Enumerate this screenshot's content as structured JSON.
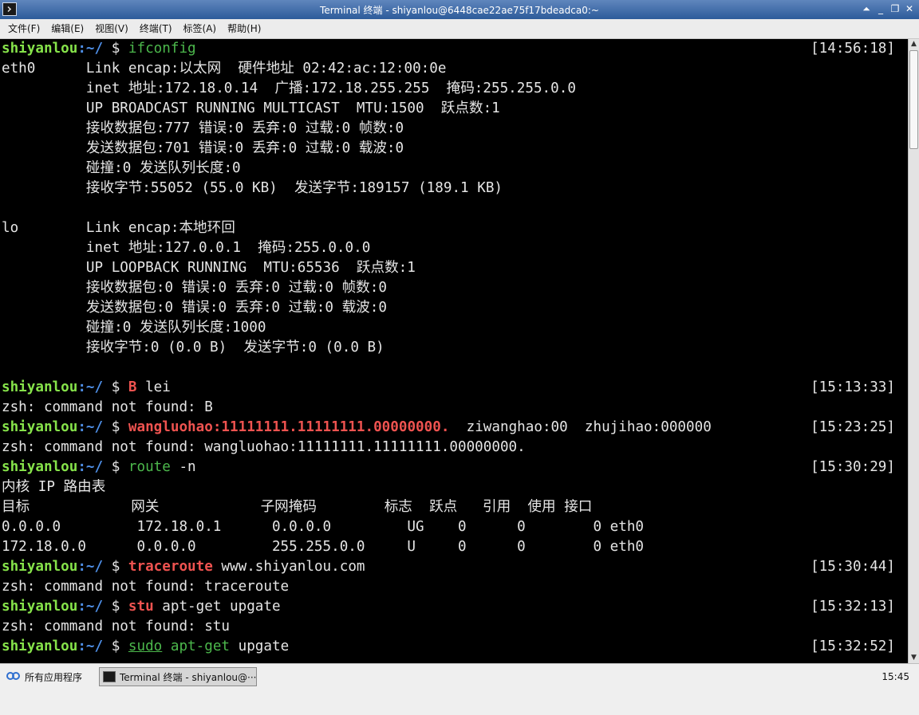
{
  "window": {
    "title": "Terminal 终端 - shiyanlou@6448cae22ae75f17bdeadca0:~",
    "controls": [
      "⏶",
      "_",
      "❐",
      "✕"
    ]
  },
  "menubar": {
    "items": [
      "文件(F)",
      "编辑(E)",
      "视图(V)",
      "终端(T)",
      "标签(A)",
      "帮助(H)"
    ]
  },
  "terminal": {
    "prompt_user": "shiyanlou",
    "prompt_path": ":~/",
    "prompt_symbol": " $ ",
    "lines": [
      {
        "type": "prompt",
        "cmd": "ifconfig",
        "cmd_style": "g",
        "ts": "[14:56:18]"
      },
      {
        "type": "out",
        "text": "eth0      Link encap:以太网  硬件地址 02:42:ac:12:00:0e"
      },
      {
        "type": "out",
        "text": "          inet 地址:172.18.0.14  广播:172.18.255.255  掩码:255.255.0.0"
      },
      {
        "type": "out",
        "text": "          UP BROADCAST RUNNING MULTICAST  MTU:1500  跃点数:1"
      },
      {
        "type": "out",
        "text": "          接收数据包:777 错误:0 丢弃:0 过载:0 帧数:0"
      },
      {
        "type": "out",
        "text": "          发送数据包:701 错误:0 丢弃:0 过载:0 载波:0"
      },
      {
        "type": "out",
        "text": "          碰撞:0 发送队列长度:0"
      },
      {
        "type": "out",
        "text": "          接收字节:55052 (55.0 KB)  发送字节:189157 (189.1 KB)"
      },
      {
        "type": "out",
        "text": ""
      },
      {
        "type": "out",
        "text": "lo        Link encap:本地环回"
      },
      {
        "type": "out",
        "text": "          inet 地址:127.0.0.1  掩码:255.0.0.0"
      },
      {
        "type": "out",
        "text": "          UP LOOPBACK RUNNING  MTU:65536  跃点数:1"
      },
      {
        "type": "out",
        "text": "          接收数据包:0 错误:0 丢弃:0 过载:0 帧数:0"
      },
      {
        "type": "out",
        "text": "          发送数据包:0 错误:0 丢弃:0 过载:0 载波:0"
      },
      {
        "type": "out",
        "text": "          碰撞:0 发送队列长度:1000"
      },
      {
        "type": "out",
        "text": "          接收字节:0 (0.0 B)  发送字节:0 (0.0 B)"
      },
      {
        "type": "out",
        "text": ""
      },
      {
        "type": "prompt",
        "cmd": "B",
        "cmd_style": "r",
        "args": " lei",
        "ts": "[15:13:33]"
      },
      {
        "type": "out",
        "text": "zsh: command not found: B"
      },
      {
        "type": "prompt",
        "cmd": "wangluohao:11111111.11111111.00000000.",
        "cmd_style": "r",
        "args": "  ziwanghao:00  zhujihao:000000",
        "ts": "[15:23:25]"
      },
      {
        "type": "out",
        "text": "zsh: command not found: wangluohao:11111111.11111111.00000000."
      },
      {
        "type": "prompt",
        "cmd": "route",
        "cmd_style": "g",
        "args": " -n",
        "ts": "[15:30:29]"
      },
      {
        "type": "out",
        "text": "内核 IP 路由表"
      },
      {
        "type": "out",
        "text": "目标            网关            子网掩码        标志  跃点   引用  使用 接口"
      },
      {
        "type": "out",
        "text": "0.0.0.0         172.18.0.1      0.0.0.0         UG    0      0        0 eth0"
      },
      {
        "type": "out",
        "text": "172.18.0.0      0.0.0.0         255.255.0.0     U     0      0        0 eth0"
      },
      {
        "type": "prompt",
        "cmd": "traceroute",
        "cmd_style": "r",
        "args": " www.shiyanlou.com",
        "ts": "[15:30:44]"
      },
      {
        "type": "out",
        "text": "zsh: command not found: traceroute"
      },
      {
        "type": "prompt",
        "cmd": "stu",
        "cmd_style": "r",
        "args": " apt-get upgate",
        "ts": "[15:32:13]"
      },
      {
        "type": "out",
        "text": "zsh: command not found: stu"
      },
      {
        "type": "prompt",
        "cmd": "sudo",
        "cmd_style": "gu",
        "args2_style": "g",
        "args2": " apt-get",
        "args": " upgate",
        "ts": "[15:32:52]"
      }
    ]
  },
  "scrollbar": {
    "up_glyph": "▲",
    "down_glyph": "▼"
  },
  "taskbar": {
    "start_label": "所有应用程序",
    "task_label": "Terminal 终端 - shiyanlou@···",
    "clock": "15:45"
  }
}
